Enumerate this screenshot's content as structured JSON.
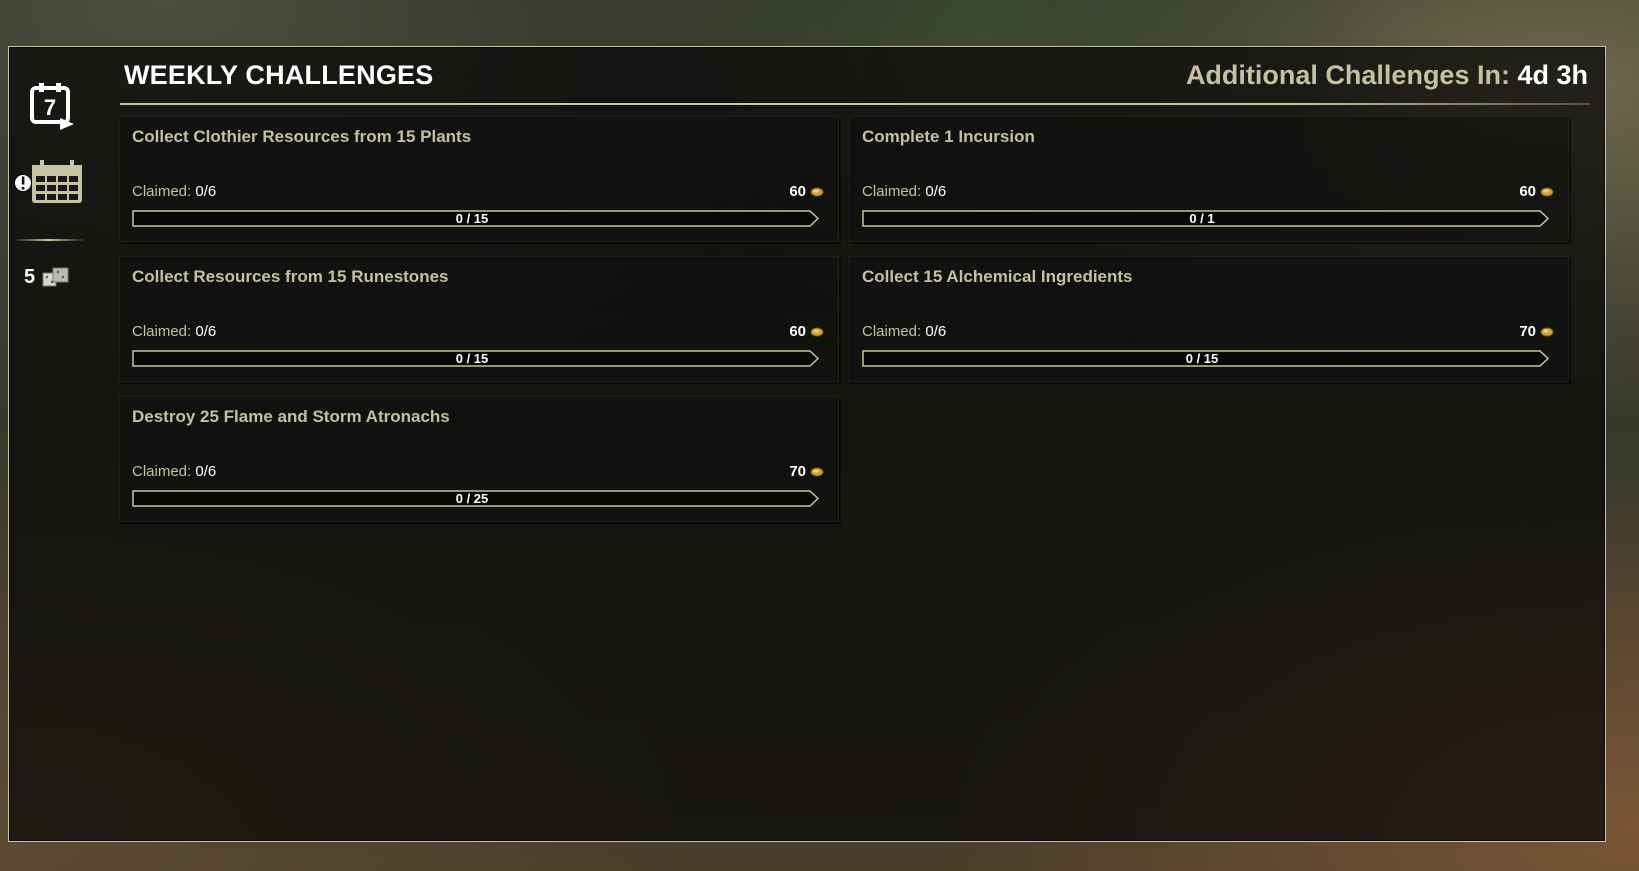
{
  "header": {
    "title": "WEEKLY CHALLENGES",
    "timer_label": "Additional Challenges In:",
    "timer_value": "4d 3h"
  },
  "sidebar": {
    "daily_icon": "calendar-7-day-icon",
    "daily_number": "7",
    "weekly_icon": "calendar-alert-icon",
    "count": "5",
    "count_icon": "endeavor-seals-icon"
  },
  "currency_icon": "seals-of-endeavor-icon",
  "colors": {
    "accent": "#c8c3a4",
    "text_tan": "#c5c0a0",
    "text_white": "#ffffff",
    "currency": "#d2a33c"
  },
  "challenges": [
    {
      "name": "Collect Clothier Resources from 15 Plants",
      "claimed_label": "Claimed:",
      "claimed_value": "0/6",
      "reward": "60",
      "progress_text": "0 / 15",
      "progress": 0
    },
    {
      "name": "Complete 1 Incursion",
      "claimed_label": "Claimed:",
      "claimed_value": "0/6",
      "reward": "60",
      "progress_text": "0 / 1",
      "progress": 0
    },
    {
      "name": "Collect Resources from 15 Runestones",
      "claimed_label": "Claimed:",
      "claimed_value": "0/6",
      "reward": "60",
      "progress_text": "0 / 15",
      "progress": 0
    },
    {
      "name": "Collect 15 Alchemical Ingredients",
      "claimed_label": "Claimed:",
      "claimed_value": "0/6",
      "reward": "70",
      "progress_text": "0 / 15",
      "progress": 0
    },
    {
      "name": "Destroy 25 Flame and Storm Atronachs",
      "claimed_label": "Claimed:",
      "claimed_value": "0/6",
      "reward": "70",
      "progress_text": "0 / 25",
      "progress": 0
    }
  ]
}
